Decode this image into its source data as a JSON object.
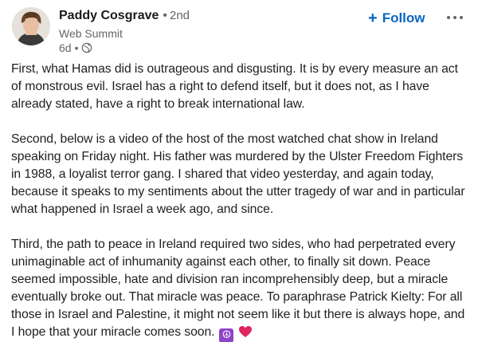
{
  "post": {
    "author": {
      "name": "Paddy Cosgrave",
      "degree": "2nd",
      "subtitle": "Web Summit",
      "time": "6d"
    },
    "follow_label": "Follow",
    "follow_icon": "+",
    "icons": {
      "globe": "globe-icon",
      "more": "more-horizontal-icon",
      "peace": "peace-symbol-icon",
      "heart": "red-heart-icon"
    },
    "colors": {
      "follow": "#0a66c2",
      "peace_bg": "#8e44c9",
      "heart": "#e0245e"
    },
    "paragraphs": [
      "First, what Hamas did is outrageous and disgusting. It is by every measure an act of monstrous evil. Israel has a right to defend itself, but it does not, as I have already stated, have a right to break international law.",
      "Second, below is a video of the host of the most watched chat show in Ireland speaking on Friday night. His father was murdered by the Ulster Freedom Fighters in 1988, a loyalist terror gang. I shared that video yesterday, and again today, because it speaks to my sentiments about the utter tragedy of war and in particular what happened in Israel a week ago, and since.",
      "Third, the path to peace in Ireland required two sides, who had perpetrated every unimaginable act of inhumanity against each other, to finally sit down. Peace seemed impossible, hate and division ran incomprehensibly deep, but a miracle eventually broke out. That miracle was peace. To paraphrase Patrick Kielty: For all those in Israel and Palestine, it might not seem like it but there is always hope, and I hope that your miracle comes soon."
    ]
  }
}
